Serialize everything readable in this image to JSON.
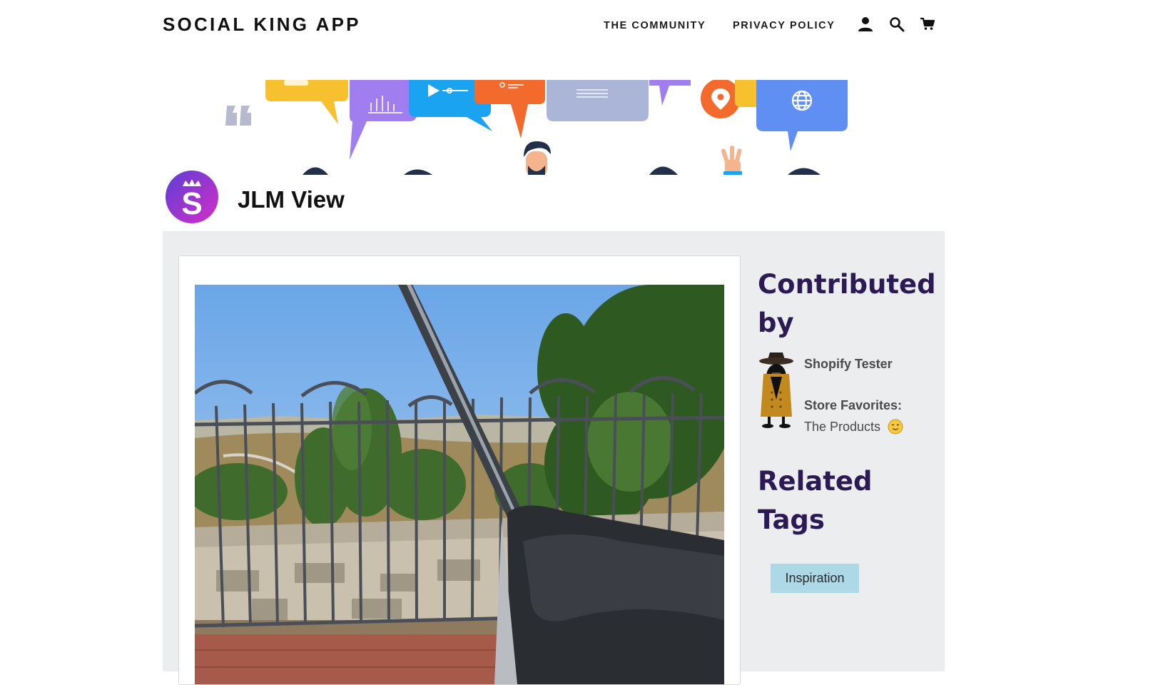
{
  "header": {
    "brand": "SOCIAL KING APP",
    "nav": [
      {
        "label": "THE COMMUNITY"
      },
      {
        "label": "PRIVACY POLICY"
      }
    ],
    "icons": [
      "account-icon",
      "search-icon",
      "cart-icon"
    ]
  },
  "page": {
    "logo_letter": "S",
    "title": "JLM View"
  },
  "sidebar": {
    "contributed_heading": "Contributed by",
    "contributor_name": "Shopify Tester",
    "favorites_label": "Store Favorites:",
    "favorites_value": "The Products",
    "related_heading": "Related Tags",
    "tags": [
      {
        "label": "Inspiration"
      }
    ]
  },
  "colors": {
    "heading": "#2c1a55",
    "content_bg": "#ebedee",
    "tag_bg": "#add8e6",
    "logo_gradient": [
      "#5b3fd6",
      "#d42ec8"
    ]
  }
}
